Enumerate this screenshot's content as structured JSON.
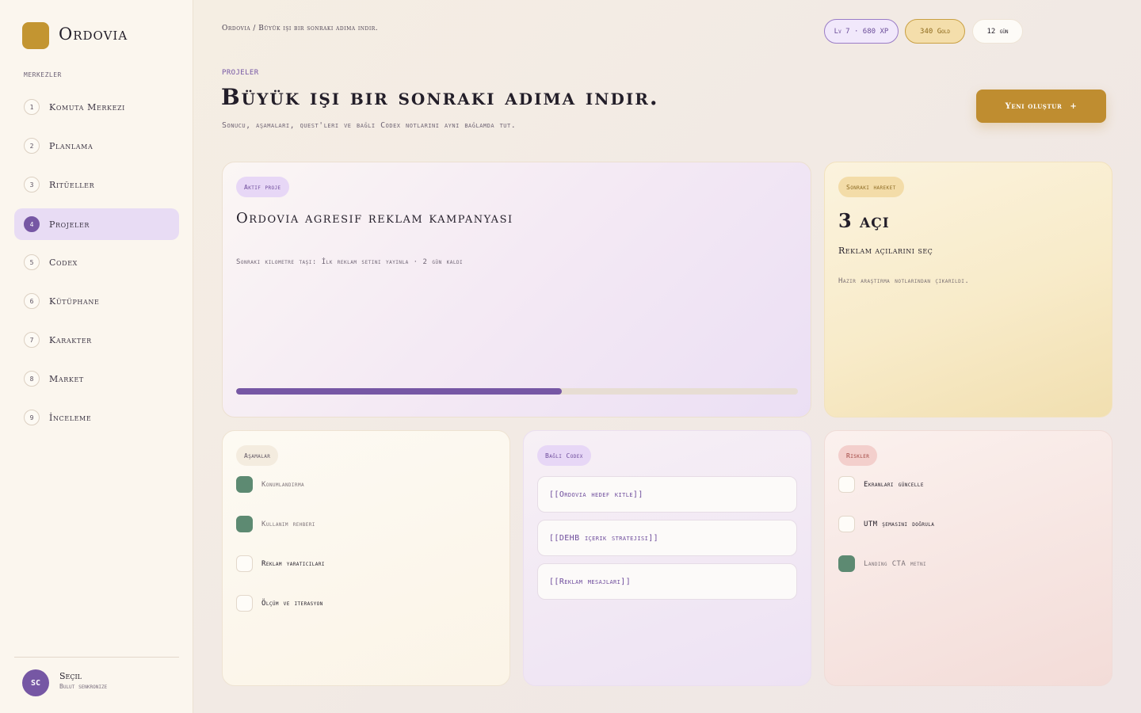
{
  "app": {
    "name": "Ordovia"
  },
  "sidebar": {
    "section_label": "MERKEZLER",
    "items": [
      {
        "num": "1",
        "label": "Komuta Merkezi"
      },
      {
        "num": "2",
        "label": "Planlama"
      },
      {
        "num": "3",
        "label": "Ritüeller"
      },
      {
        "num": "4",
        "label": "Projeler",
        "active": true
      },
      {
        "num": "5",
        "label": "Codex"
      },
      {
        "num": "6",
        "label": "Kütüphane"
      },
      {
        "num": "7",
        "label": "Karakter"
      },
      {
        "num": "8",
        "label": "Market"
      },
      {
        "num": "9",
        "label": "İnceleme"
      }
    ],
    "user": {
      "initials": "SC",
      "name": "Seçil",
      "status": "Bulut senkronize"
    }
  },
  "header": {
    "breadcrumb": "Ordovia / Büyük işi bir sonraki adıma indir.",
    "level": "Lv 7 · 680 XP",
    "gold": "340 Gold",
    "streak": "12 gün"
  },
  "page": {
    "eyebrow": "PROJELER",
    "title": "Büyük işi bir sonraki adıma indir.",
    "subtitle": "Sonucu, aşamaları, quest'leri ve bağlı Codex notlarını aynı bağlamda tut.",
    "cta_label": "Yeni oluştur",
    "cta_icon": "+"
  },
  "project_card": {
    "tag": "Aktif proje",
    "title": "Ordovia agresif reklam kampanyası",
    "meta": "Sonraki kilometre taşı: İlk reklam setini yayınla · 2 gün kaldı",
    "progress_percent": 58,
    "progress_color": "#7657a4"
  },
  "next_card": {
    "tag": "Sonraki hareket",
    "big": "3 açı",
    "subtitle": "Reklam açılarını seç",
    "note": "Hazır araştırma notlarından çıkarıldı."
  },
  "stages_card": {
    "tag": "Aşamalar",
    "items": [
      {
        "label": "Konumlandırma",
        "done": true
      },
      {
        "label": "Kullanım rehberi",
        "done": true
      },
      {
        "label": "Reklam yaratıcıları",
        "done": false
      },
      {
        "label": "Ölçüm ve iterasyon",
        "done": false
      }
    ]
  },
  "codex_card": {
    "tag": "Bağlı Codex",
    "items": [
      {
        "label": "[[Ordovia hedef kitle]]"
      },
      {
        "label": "[[DEHB içerik stratejisi]]"
      },
      {
        "label": "[[Reklam mesajları]]"
      }
    ]
  },
  "risks_card": {
    "tag": "Riskler",
    "items": [
      {
        "label": "Ekranları güncelle",
        "done": false
      },
      {
        "label": "UTM şemasını doğrula",
        "done": false
      },
      {
        "label": "Landing CTA metni",
        "done": true
      }
    ]
  },
  "colors": {
    "accent": "#7657a4",
    "gold": "#bf8d30",
    "done": "#5d8a72"
  }
}
